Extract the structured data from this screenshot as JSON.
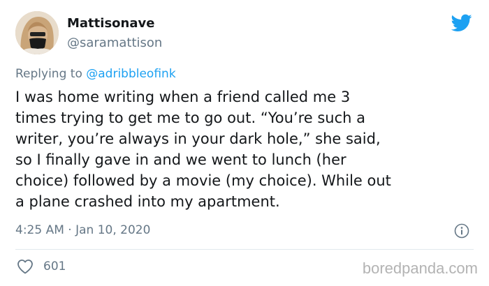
{
  "tweet": {
    "author": {
      "display_name": "Mattisonave",
      "handle": "@saramattison"
    },
    "reply_prefix": "Replying to ",
    "reply_to": "@adribbleofink",
    "text": "I was home writing when a friend called me 3\ntimes trying to get me to go out. “You’re such a\nwriter, you’re always in your dark hole,” she said,\nso I finally gave in and we went to lunch (her\nchoice) followed by a movie (my choice). While out\na plane crashed into my apartment.",
    "timestamp": "4:25 AM · Jan 10, 2020",
    "likes": "601"
  },
  "watermark": "boredpanda.com",
  "icons": {
    "brand": "twitter-bird-icon",
    "info": "info-icon",
    "like": "heart-icon"
  },
  "colors": {
    "accent": "#1da1f2",
    "secondary_text": "#657786",
    "primary_text": "#14171a",
    "divider": "#e1e8ed"
  }
}
